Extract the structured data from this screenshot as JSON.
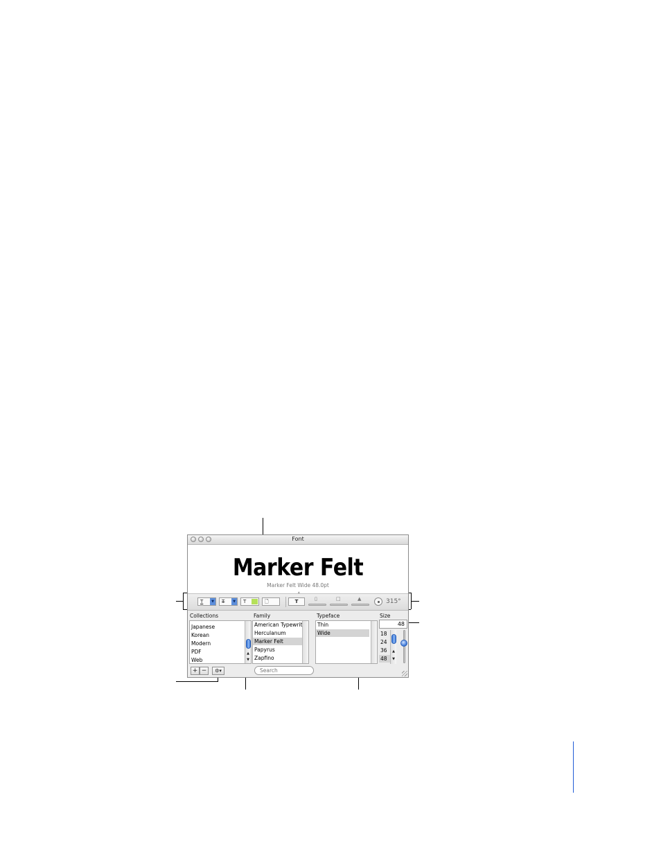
{
  "window": {
    "title": "Font"
  },
  "preview": {
    "sample_text": "Marker Felt",
    "description": "Marker Felt Wide 48.0pt"
  },
  "effects": {
    "underline_glyph": "T",
    "strikethrough_glyph": "T",
    "text_color_glyph": "T",
    "document_glyph": "🗋",
    "shadow_glyph": "T",
    "shadow_angle": "315°",
    "text_color_swatch": "#b5e05a",
    "underline_swatch": "#5d8fdc"
  },
  "columns": {
    "collections_label": "Collections",
    "family_label": "Family",
    "typeface_label": "Typeface",
    "size_label": "Size"
  },
  "collections": [
    "Japanese",
    "Korean",
    "Modern",
    "PDF",
    "Web"
  ],
  "families": [
    "American Typewriter",
    "Herculanum",
    "Marker Felt",
    "Papyrus",
    "Zapfino"
  ],
  "selected_family": "Marker Felt",
  "typefaces": [
    "Thin",
    "Wide"
  ],
  "selected_typeface": "Wide",
  "size": {
    "value": "48",
    "options": [
      "18",
      "24",
      "36",
      "48"
    ],
    "selected": "48"
  },
  "toolbar": {
    "add_label": "+",
    "remove_label": "−",
    "action_label": "⚙▾",
    "search_placeholder": "Search"
  },
  "colors": {
    "selection_blue": "#5d8fdc",
    "page_bar": "#1f5bd6"
  }
}
